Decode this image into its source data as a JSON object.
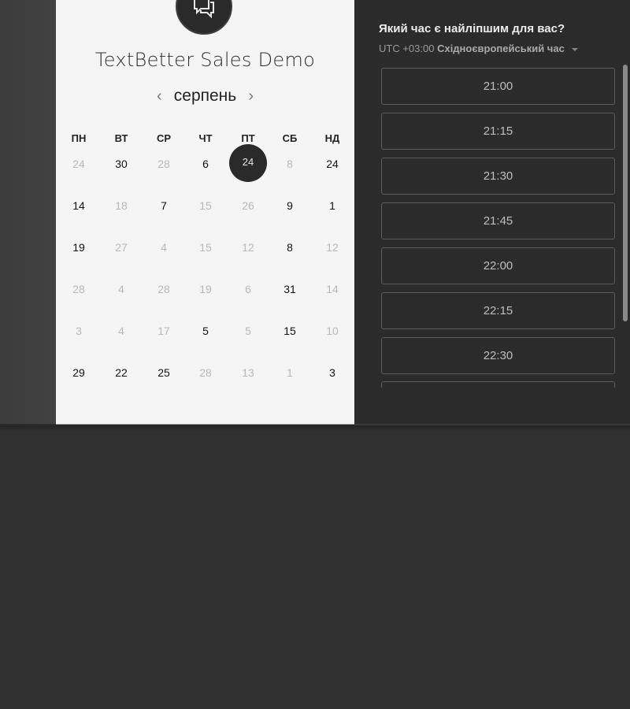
{
  "calendar": {
    "title": "TextBetter Sales Demo",
    "month": "серпень",
    "prev_arrow": "‹",
    "next_arrow": "›",
    "weekdays": [
      "ПН",
      "ВТ",
      "СР",
      "ЧТ",
      "ПТ",
      "СБ",
      "НД"
    ],
    "weeks": [
      [
        {
          "d": "24",
          "s": "muted"
        },
        {
          "d": "30",
          "s": "avail"
        },
        {
          "d": "28",
          "s": "muted"
        },
        {
          "d": "6",
          "s": "avail"
        },
        {
          "d": "24",
          "s": "selected"
        },
        {
          "d": "8",
          "s": "muted"
        },
        {
          "d": "24",
          "s": "avail"
        }
      ],
      [
        {
          "d": "14",
          "s": "avail"
        },
        {
          "d": "18",
          "s": "muted"
        },
        {
          "d": "7",
          "s": "avail"
        },
        {
          "d": "15",
          "s": "muted"
        },
        {
          "d": "26",
          "s": "muted"
        },
        {
          "d": "9",
          "s": "avail"
        },
        {
          "d": "1",
          "s": "avail"
        }
      ],
      [
        {
          "d": "19",
          "s": "avail"
        },
        {
          "d": "27",
          "s": "muted"
        },
        {
          "d": "4",
          "s": "muted"
        },
        {
          "d": "15",
          "s": "muted"
        },
        {
          "d": "12",
          "s": "muted"
        },
        {
          "d": "8",
          "s": "avail"
        },
        {
          "d": "12",
          "s": "muted"
        }
      ],
      [
        {
          "d": "28",
          "s": "muted"
        },
        {
          "d": "4",
          "s": "muted"
        },
        {
          "d": "28",
          "s": "muted"
        },
        {
          "d": "19",
          "s": "muted"
        },
        {
          "d": "6",
          "s": "muted"
        },
        {
          "d": "31",
          "s": "avail"
        },
        {
          "d": "14",
          "s": "muted"
        }
      ],
      [
        {
          "d": "3",
          "s": "muted"
        },
        {
          "d": "4",
          "s": "muted"
        },
        {
          "d": "17",
          "s": "muted"
        },
        {
          "d": "5",
          "s": "avail"
        },
        {
          "d": "5",
          "s": "muted"
        },
        {
          "d": "15",
          "s": "avail"
        },
        {
          "d": "10",
          "s": "muted"
        }
      ],
      [
        {
          "d": "29",
          "s": "avail"
        },
        {
          "d": "22",
          "s": "avail"
        },
        {
          "d": "25",
          "s": "avail"
        },
        {
          "d": "28",
          "s": "muted"
        },
        {
          "d": "13",
          "s": "muted"
        },
        {
          "d": "1",
          "s": "muted"
        },
        {
          "d": "3",
          "s": "avail"
        }
      ]
    ]
  },
  "times": {
    "question": "Який час є найліпшим для вас?",
    "timezone_offset": "UTC +03:00",
    "timezone_name": "Східноєвропейський час",
    "slots": [
      "21:00",
      "21:15",
      "21:30",
      "21:45",
      "22:00",
      "22:15",
      "22:30"
    ]
  },
  "colors": {
    "card": "#f5f5f5",
    "panel": "#2b2b2b",
    "background": "#303030"
  },
  "icons": {
    "logo": "chat-bubbles-icon",
    "prev": "chevron-left-icon",
    "next": "chevron-right-icon",
    "tz": "caret-down-icon"
  }
}
